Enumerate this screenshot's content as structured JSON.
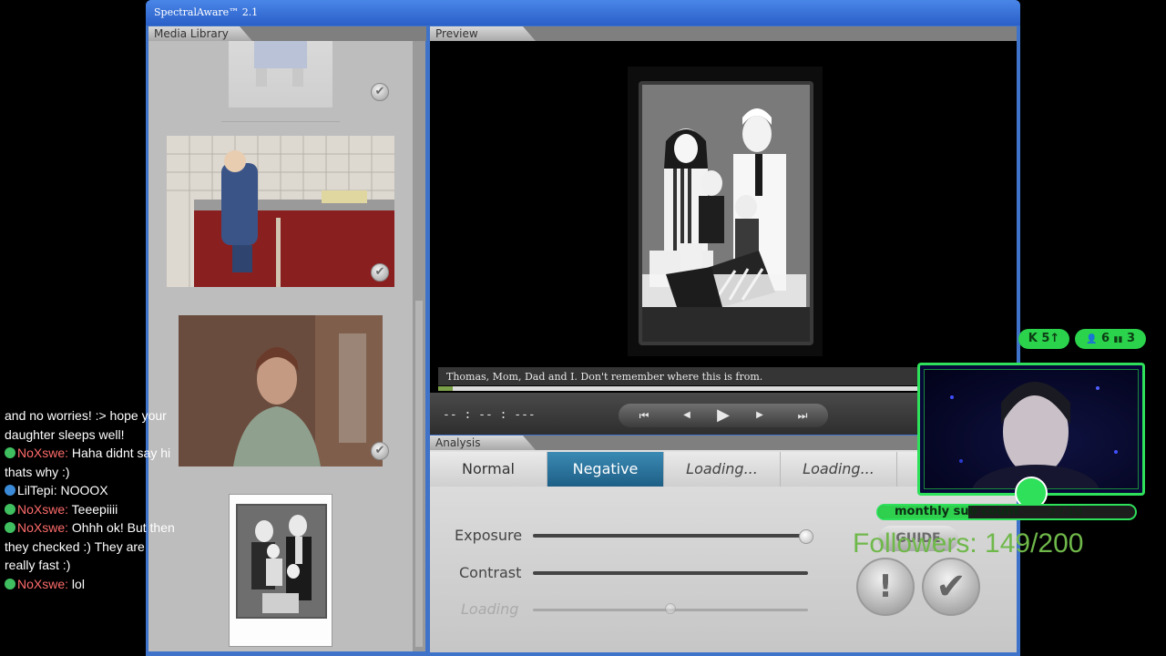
{
  "window": {
    "title": "SpectralAware™ 2.1"
  },
  "panels": {
    "media_library": "Media Library",
    "preview": "Preview",
    "analysis": "Analysis"
  },
  "preview": {
    "caption": "Thomas, Mom, Dad and I. Don't remember where this is from.",
    "timecode": "-- : -- : ---",
    "progress": 0.03
  },
  "transport": {
    "rewind": "⏮",
    "prev": "◀",
    "play": "▶",
    "next": "▶",
    "forward": "⏭"
  },
  "analysis": {
    "tabs": [
      {
        "label": "Normal",
        "active": false
      },
      {
        "label": "Negative",
        "active": true
      },
      {
        "label": "Loading...",
        "active": false
      },
      {
        "label": "Loading...",
        "active": false
      }
    ],
    "sliders": [
      {
        "label": "Exposure",
        "value": 1.0
      },
      {
        "label": "Contrast",
        "value": 0.55
      },
      {
        "label": "Loading",
        "value": 0.5
      }
    ],
    "guide_label": "GUIDE",
    "alert_symbol": "!",
    "confirm_symbol": "✔"
  },
  "stream": {
    "chat": [
      {
        "user": "",
        "text": "and no worries! :> hope your daughter sleeps well!"
      },
      {
        "user": "NoXswe:",
        "text": "Haha didnt say hi thats why :)"
      },
      {
        "user": "LilTepi:",
        "text": "NOOOX"
      },
      {
        "user": "NoXswe:",
        "text": "Teeepiiii"
      },
      {
        "user": "NoXswe:",
        "text": "Ohhh ok! But then they checked :) They are really fast :)"
      },
      {
        "user": "NoXswe:",
        "text": "lol"
      }
    ],
    "stats": [
      {
        "icon": "K",
        "value": "5",
        "suffix": "↑"
      },
      {
        "icon": "👤",
        "value": "6",
        "suffix": ""
      },
      {
        "icon": "▮▮",
        "value": "3",
        "suffix": ""
      }
    ],
    "sub_label": "monthly sub count",
    "sub_count": "3 / 10",
    "sub_fraction": 0.3,
    "followers": "Followers: 149/200"
  },
  "colors": {
    "accent_green": "#2ee05a",
    "tab_active": "#1e5f86",
    "title_blue": "#2a5fc8"
  }
}
